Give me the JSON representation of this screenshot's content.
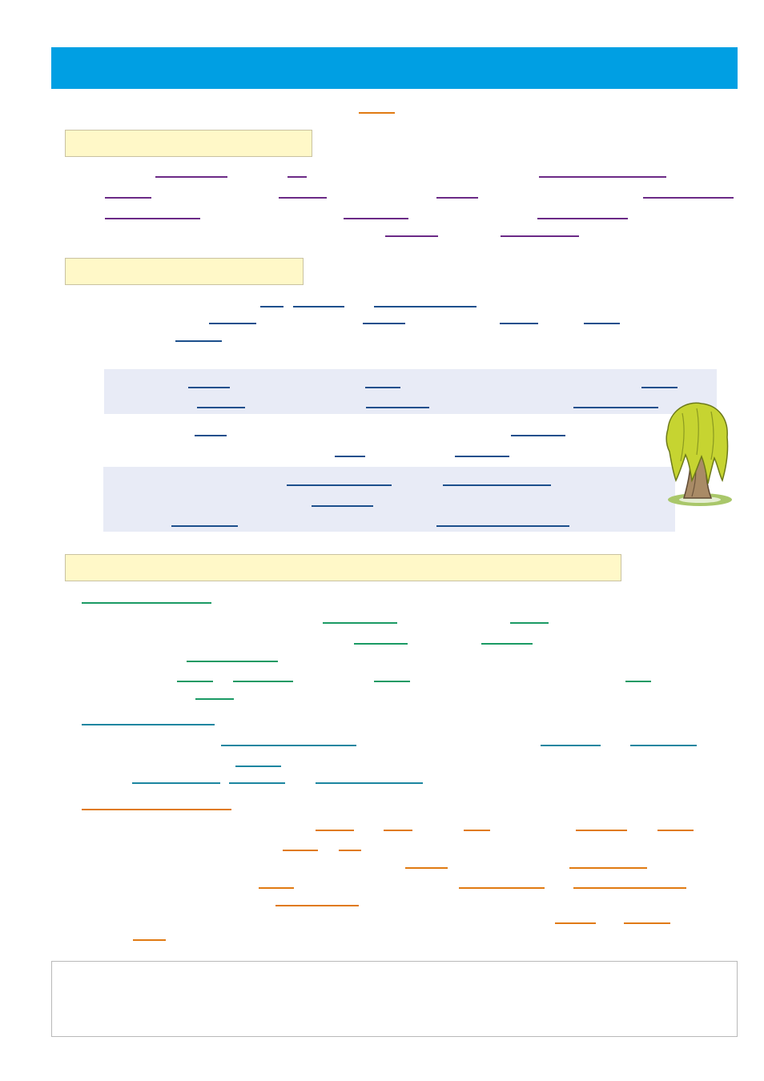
{
  "colors": {
    "title_bar": "#009fe3",
    "section_header_fill": "#fff8c8",
    "shaded_box": "#e8ebf6",
    "purple_blanks": "#6b2a86",
    "blue_blanks": "#1c4f8c",
    "green_blanks": "#1a9a64",
    "teal_blanks": "#1c86a0",
    "orange_blanks": "#e07a12"
  },
  "icons": {
    "illustration": "weeping-willow-tree-icon"
  }
}
